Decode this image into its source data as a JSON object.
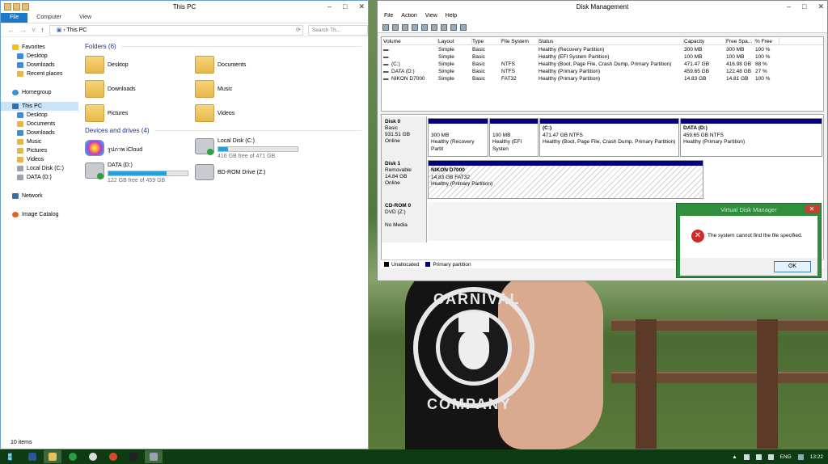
{
  "explorer": {
    "title": "This PC",
    "tabs": [
      "File",
      "Computer",
      "View"
    ],
    "address": "This PC",
    "search_placeholder": "Search Th...",
    "nav": {
      "favorites": "Favorites",
      "fav_items": [
        "Desktop",
        "Downloads",
        "Recent places"
      ],
      "homegroup": "Homegroup",
      "thispc": "This PC",
      "pc_items": [
        "Desktop",
        "Documents",
        "Downloads",
        "Music",
        "Pictures",
        "Videos",
        "Local Disk (C:)",
        "DATA (D:)"
      ],
      "network": "Network",
      "image_catalog": "Image Catalog"
    },
    "folders_heading": "Folders (6)",
    "folders": [
      "Desktop",
      "Documents",
      "Downloads",
      "Music",
      "Pictures",
      "Videos"
    ],
    "devices_heading": "Devices and drives (4)",
    "drives": {
      "icloud": {
        "name": "รูปภาพ iCloud"
      },
      "c": {
        "name": "Local Disk (C:)",
        "free": "416 GB free of 471 GB",
        "used_fraction": 0.12
      },
      "d": {
        "name": "DATA (D:)",
        "free": "122 GB free of 459 GB",
        "used_fraction": 0.73
      },
      "z": {
        "name": "BD-ROM Drive (Z:)"
      }
    },
    "status": "10 items"
  },
  "diskmgmt": {
    "title": "Disk Management",
    "menu": [
      "File",
      "Action",
      "View",
      "Help"
    ],
    "columns": [
      "Volume",
      "Layout",
      "Type",
      "File System",
      "Status",
      "Capacity",
      "Free Spa...",
      "% Free"
    ],
    "rows": [
      [
        "",
        "Simple",
        "Basic",
        "",
        "Healthy (Recovery Partition)",
        "300 MB",
        "300 MB",
        "100 %"
      ],
      [
        "",
        "Simple",
        "Basic",
        "",
        "Healthy (EFI System Partition)",
        "100 MB",
        "100 MB",
        "100 %"
      ],
      [
        "(C:)",
        "Simple",
        "Basic",
        "NTFS",
        "Healthy (Boot, Page File, Crash Dump, Primary Partition)",
        "471.47 GB",
        "416.98 GB",
        "88 %"
      ],
      [
        "DATA (D:)",
        "Simple",
        "Basic",
        "NTFS",
        "Healthy (Primary Partition)",
        "459.65 GB",
        "122.48 GB",
        "27 %"
      ],
      [
        "NIKON D7000",
        "Simple",
        "Basic",
        "FAT32",
        "Healthy (Primary Partition)",
        "14.83 GB",
        "14.81 GB",
        "100 %"
      ]
    ],
    "disk0": {
      "label": [
        "Disk 0",
        "Basic",
        "931.51 GB",
        "Online"
      ],
      "parts": [
        {
          "title": "",
          "size": "300 MB",
          "status": "Healthy (Recovery Partit"
        },
        {
          "title": "",
          "size": "100 MB",
          "status": "Healthy (EFI Systen"
        },
        {
          "title": "(C:)",
          "size": "471.47 GB NTFS",
          "status": "Healthy (Boot, Page File, Crash Dump, Primary Partition)"
        },
        {
          "title": "DATA (D:)",
          "size": "459.65 GB NTFS",
          "status": "Healthy (Primary Partition)"
        }
      ]
    },
    "disk1": {
      "label": [
        "Disk 1",
        "Removable",
        "14.84 GB",
        "Online"
      ],
      "part": {
        "title": "NIKON D7000",
        "size": "14.83 GB FAT32",
        "status": "Healthy (Primary Partition)"
      }
    },
    "cdrom": {
      "label": [
        "CD-ROM 0",
        "DVD (Z:)",
        "",
        "No Media"
      ]
    },
    "legend": [
      "Unallocated",
      "Primary partition"
    ]
  },
  "dialog": {
    "title": "Virtual Disk Manager",
    "message": "The system cannot find the file specified.",
    "ok": "OK"
  },
  "taskbar": {
    "lang": "ENG",
    "time": "13:22"
  },
  "wallpaper": {
    "shirt_text_top": "CARNIVAL",
    "shirt_text_bottom": "COMPANY"
  },
  "colors": {
    "accent": "#1979ca",
    "dialog_frame": "#2f8f3f",
    "partition_header": "#000080"
  }
}
